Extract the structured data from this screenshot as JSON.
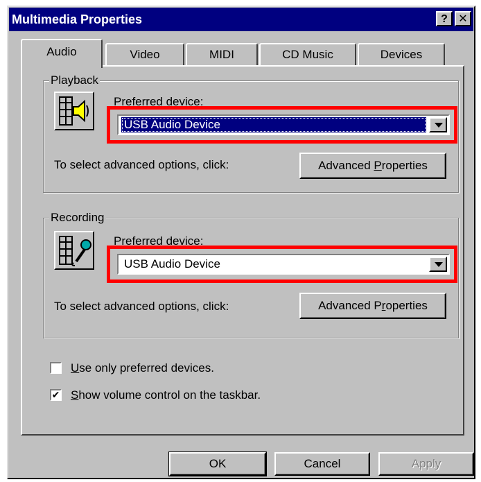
{
  "window": {
    "title": "Multimedia Properties",
    "help_label": "?",
    "close_label": "✕"
  },
  "tabs": [
    {
      "label": "Audio",
      "active": true
    },
    {
      "label": "Video",
      "active": false
    },
    {
      "label": "MIDI",
      "active": false
    },
    {
      "label": "CD Music",
      "active": false
    },
    {
      "label": "Devices",
      "active": false
    }
  ],
  "playback": {
    "group_label": "Playback",
    "preferred_label": "Preferred device:",
    "device_value": "USB Audio Device",
    "advanced_text": "To select advanced options, click:",
    "advanced_button_pre": "Advanced ",
    "advanced_button_u": "P",
    "advanced_button_post": "roperties",
    "icon": "speaker-icon"
  },
  "recording": {
    "group_label": "Recording",
    "preferred_label": "Preferred device:",
    "device_value": "USB Audio Device",
    "advanced_text": "To select advanced options, click:",
    "advanced_button_pre": "Advanced P",
    "advanced_button_u": "r",
    "advanced_button_post": "operties",
    "icon": "microphone-icon"
  },
  "options": {
    "use_preferred_u": "U",
    "use_preferred_rest": "se only preferred devices.",
    "use_preferred_checked": false,
    "show_volume_u": "S",
    "show_volume_rest": "how volume control on the taskbar.",
    "show_volume_checked": true,
    "check_mark": "✔"
  },
  "buttons": {
    "ok": "OK",
    "cancel": "Cancel",
    "apply": "Apply"
  },
  "colors": {
    "title_bar": "#000080",
    "face": "#c0c0c0",
    "highlight": "#ff0000"
  }
}
